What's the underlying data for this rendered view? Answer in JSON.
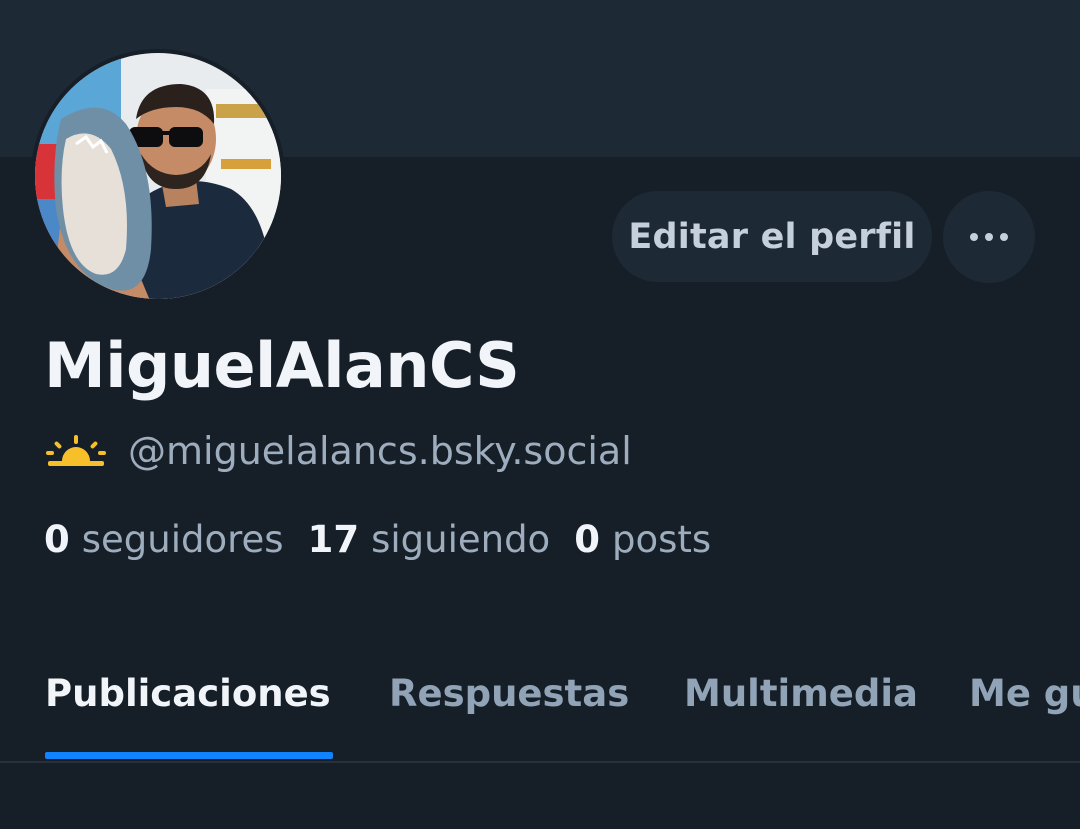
{
  "profile": {
    "display_name": "MiguelAlanCS",
    "handle": "@miguelalancs.bsky.social",
    "avatar_icon": "avatar-photo"
  },
  "actions": {
    "edit_label": "Editar el perfil",
    "more_icon": "more-horizontal-icon"
  },
  "stats": {
    "followers_count": "0",
    "followers_label": "seguidores",
    "following_count": "17",
    "following_label": "siguiendo",
    "posts_count": "0",
    "posts_label": "posts"
  },
  "tabs": [
    {
      "label": "Publicaciones",
      "active": true
    },
    {
      "label": "Respuestas",
      "active": false
    },
    {
      "label": "Multimedia",
      "active": false
    },
    {
      "label": "Me gusta",
      "active": false
    }
  ],
  "colors": {
    "background": "#161e27",
    "banner": "#1e2936",
    "accent": "#1183fe",
    "sun": "#f7c02a"
  }
}
